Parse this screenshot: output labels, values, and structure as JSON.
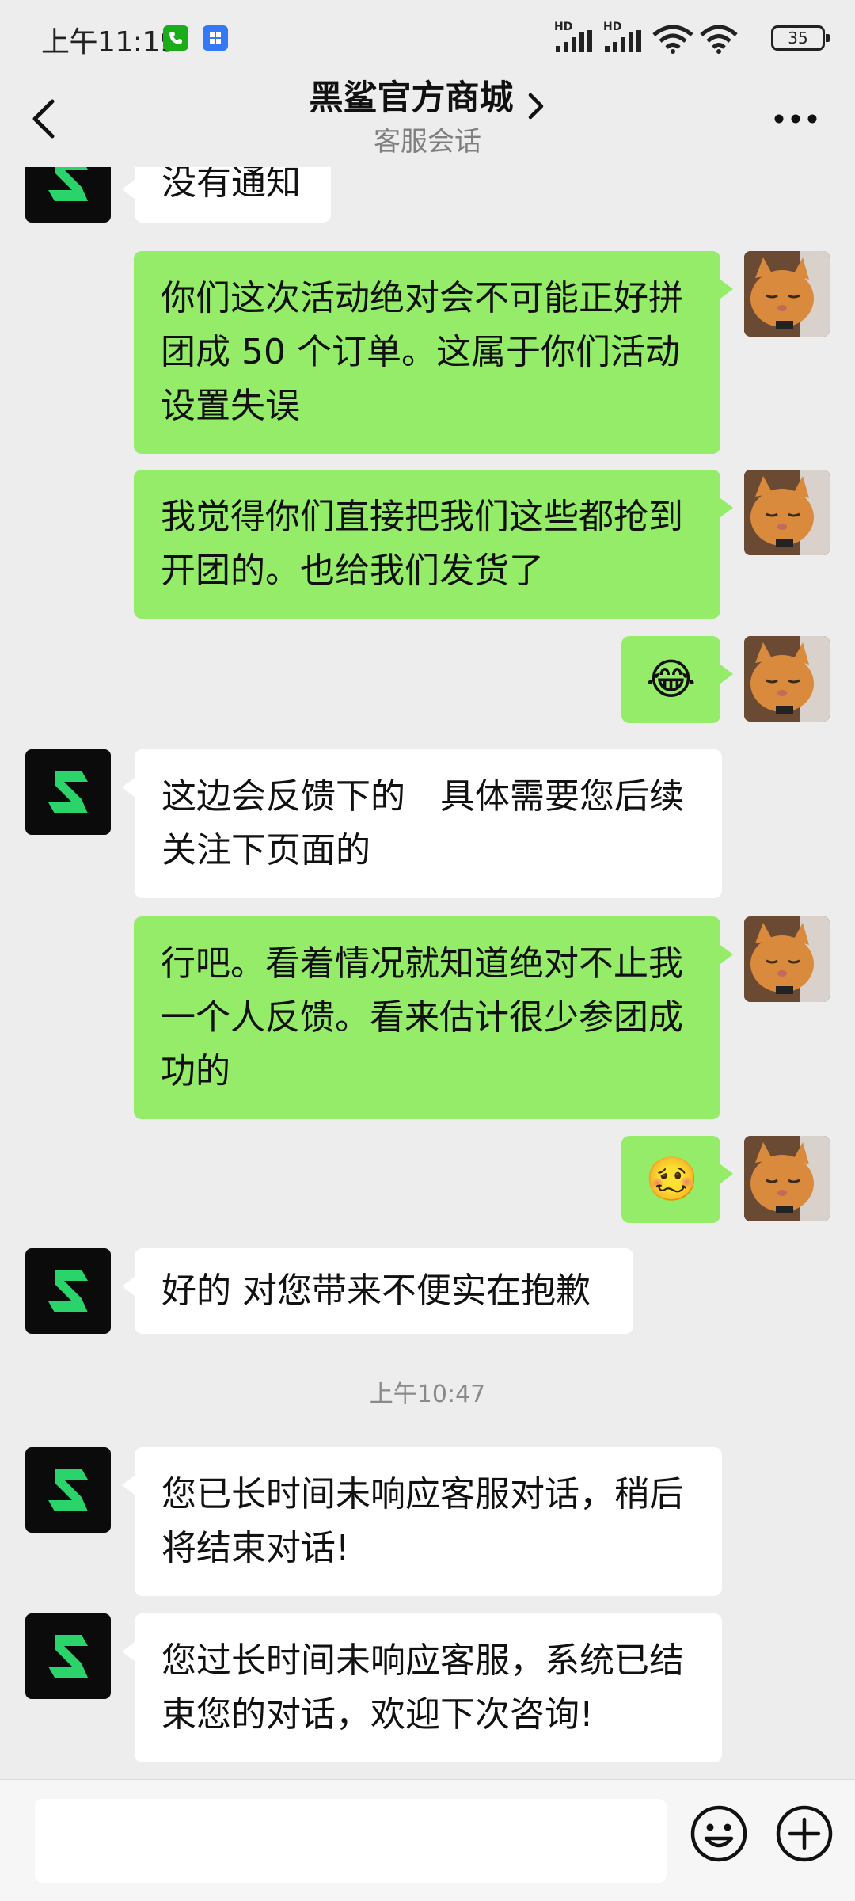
{
  "status_bar": {
    "time": "上午11:19",
    "battery": "35",
    "network_labels": [
      "HD",
      "HD"
    ]
  },
  "header": {
    "title": "黑鲨官方商城",
    "subtitle": "客服会话"
  },
  "messages": [
    {
      "from": "shop",
      "text": "没有通知"
    },
    {
      "from": "me",
      "text": "你们这次活动绝对会不可能正好拼团成 50 个订单。这属于你们活动设置失误"
    },
    {
      "from": "me",
      "text": "我觉得你们直接把我们这些都抢到开团的。也给我们发货了"
    },
    {
      "from": "me",
      "emoji": "😂"
    },
    {
      "from": "shop",
      "text": "这边会反馈下的　具体需要您后续关注下页面的"
    },
    {
      "from": "me",
      "text": "行吧。看着情况就知道绝对不止我一个人反馈。看来估计很少参团成功的"
    },
    {
      "from": "me",
      "emoji": "🥴"
    },
    {
      "from": "shop",
      "text": "好的 对您带来不便实在抱歉"
    },
    {
      "divider": "上午10:47"
    },
    {
      "from": "shop",
      "text": "您已长时间未响应客服对话，稍后将结束对话!"
    },
    {
      "from": "shop",
      "text": "您过长时间未响应客服，系统已结束您的对话，欢迎下次咨询!"
    }
  ],
  "input": {
    "value": "",
    "placeholder": ""
  },
  "colors": {
    "background": "#ededed",
    "outgoing_bubble": "#95ec69",
    "incoming_bubble": "#ffffff",
    "shop_logo_green": "#2ad46b"
  },
  "icons": {
    "back": "chevron-left-icon",
    "title_chevron": "chevron-right-icon",
    "more": "more-dots-icon",
    "emoji": "emoji-icon",
    "plus": "plus-icon"
  }
}
